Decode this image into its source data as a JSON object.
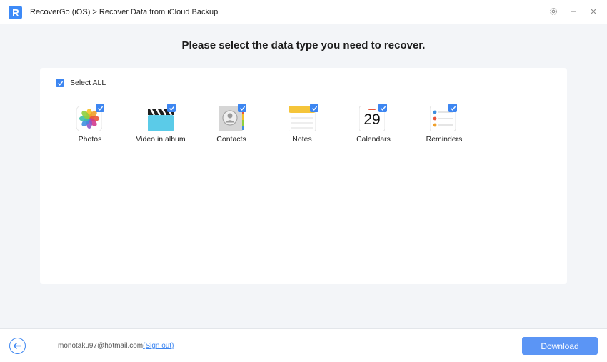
{
  "window": {
    "breadcrumb": "RecoverGo (iOS) > Recover Data from iCloud Backup",
    "logo_letter": "R",
    "icons": {
      "settings": "gear-icon",
      "minimize": "minimize-icon",
      "close": "close-icon"
    }
  },
  "main": {
    "heading": "Please select the data type you need to recover.",
    "select_all": {
      "label": "Select ALL",
      "checked": true
    },
    "data_types": [
      {
        "label": "Photos",
        "icon": "photos-icon",
        "checked": true
      },
      {
        "label": "Video in album",
        "icon": "video-clapper-icon",
        "checked": true
      },
      {
        "label": "Contacts",
        "icon": "contacts-icon",
        "checked": true
      },
      {
        "label": "Notes",
        "icon": "notes-icon",
        "checked": true
      },
      {
        "label": "Calendars",
        "icon": "calendar-icon",
        "checked": true,
        "calendar_day": "29"
      },
      {
        "label": "Reminders",
        "icon": "reminders-icon",
        "checked": true
      }
    ]
  },
  "footer": {
    "account_email": "monotaku97@hotmail.com",
    "sign_out_label": "(Sign out)",
    "download_label": "Download",
    "back_icon": "back-arrow-icon"
  },
  "colors": {
    "accent": "#3d86f1",
    "button": "#5b95f5",
    "background": "#f3f5f8"
  }
}
